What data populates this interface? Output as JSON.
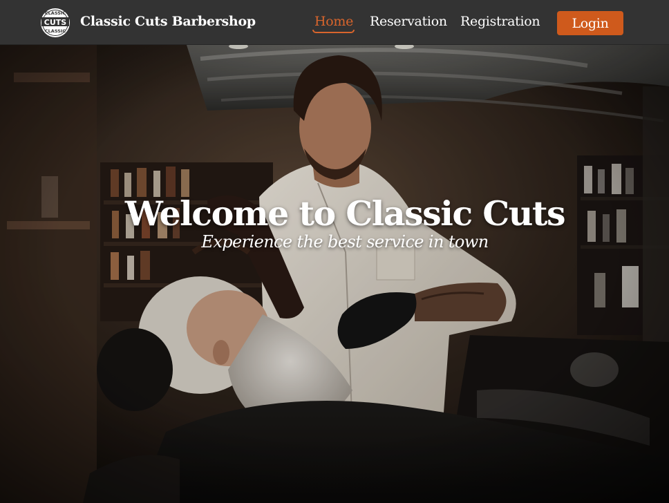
{
  "header": {
    "logo": {
      "top_text": "CLASSIC",
      "main_text": "CUTS",
      "bottom_text": "CLASSIC"
    },
    "brand_name": "Classic Cuts Barbershop",
    "nav": {
      "home": "Home",
      "reservation": "Reservation",
      "registration": "Registration"
    },
    "login_label": "Login",
    "active_item": "Home"
  },
  "hero": {
    "title": "Welcome to Classic Cuts",
    "subtitle": "Experience the best service in town",
    "image_subject": "barber trimming an older client's white beard in a dimly lit barbershop"
  },
  "colors": {
    "navbar_bg": "#333333",
    "accent": "#cf5a1c",
    "active_link": "#d9652c",
    "text": "#ffffff"
  },
  "icons": {
    "logo": "barbershop-logo-icon"
  }
}
